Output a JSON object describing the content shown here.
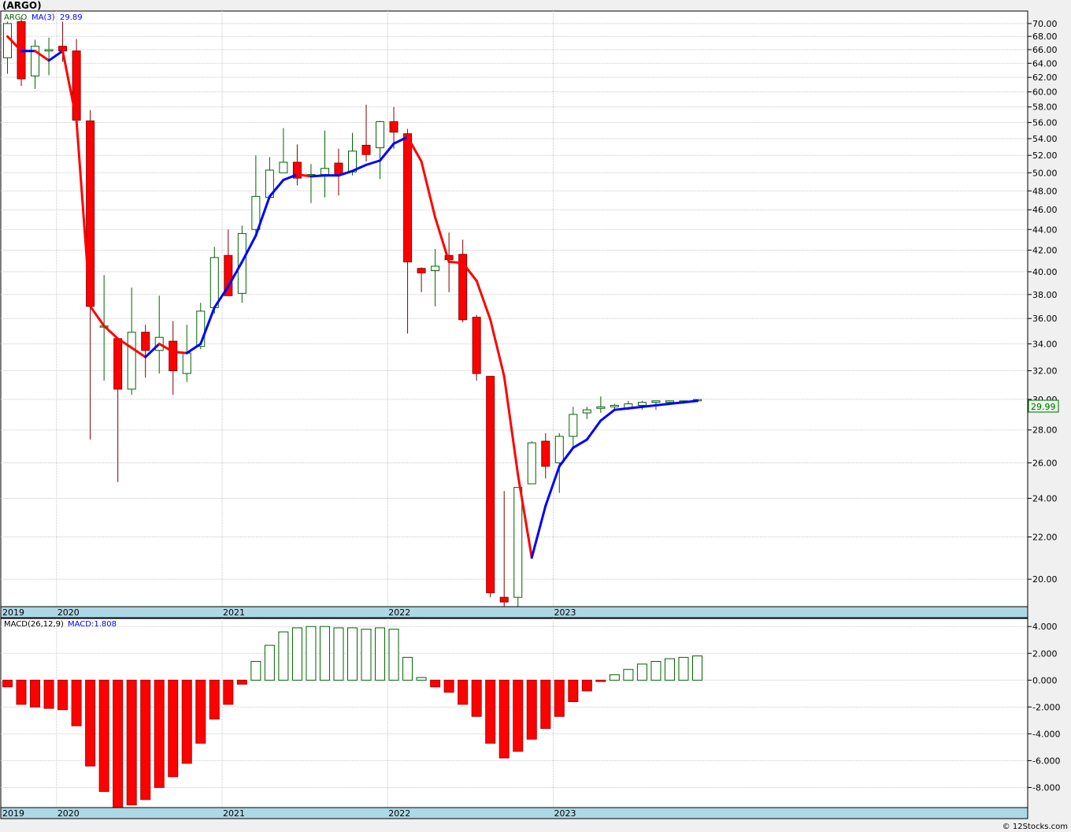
{
  "header": {
    "symbol_title": "(ARGO)",
    "footer_credit": "© 12Stocks.com"
  },
  "price_panel": {
    "legend_symbol": "ARGO",
    "legend_ma": "MA(3)",
    "legend_ma_value": "29.89",
    "last_price_label": "29.99"
  },
  "macd_panel": {
    "legend_macd": "MACD(26,12,9)",
    "legend_macd_value": "MACD:1.808"
  },
  "colors": {
    "down_fill": "#ff0000",
    "up_fill": "#ffffff",
    "up_border": "#006400",
    "ma_up": "#0000ff",
    "ma_down": "#ff0000",
    "macd_pos_border": "#006400",
    "macd_neg_fill": "#ff0000",
    "time_axis_bg": "#add8e6",
    "last_price_bg": "#e6ffe6"
  },
  "chart_data": [
    {
      "type": "candlestick",
      "title": "(ARGO)",
      "scale": "log",
      "ylim": [
        18.8,
        72.0
      ],
      "yticks": [
        "20.00",
        "22.00",
        "24.00",
        "26.00",
        "28.00",
        "30.00",
        "32.00",
        "34.00",
        "36.00",
        "38.00",
        "40.00",
        "42.00",
        "44.00",
        "46.00",
        "48.00",
        "50.00",
        "52.00",
        "54.00",
        "56.00",
        "58.00",
        "60.00",
        "62.00",
        "64.00",
        "66.00",
        "68.00",
        "70.00"
      ],
      "year_labels": [
        {
          "label": "2019",
          "index": 0
        },
        {
          "label": "2020",
          "index": 4
        },
        {
          "label": "2021",
          "index": 16
        },
        {
          "label": "2022",
          "index": 28
        },
        {
          "label": "2023",
          "index": 40
        }
      ],
      "candles": [
        {
          "o": 64.8,
          "h": 70.3,
          "l": 62.5,
          "c": 70.0
        },
        {
          "o": 70.3,
          "h": 70.8,
          "l": 60.8,
          "c": 61.8
        },
        {
          "o": 62.2,
          "h": 67.5,
          "l": 60.4,
          "c": 66.5
        },
        {
          "o": 65.8,
          "h": 67.8,
          "l": 62.3,
          "c": 66.0
        },
        {
          "o": 66.5,
          "h": 70.3,
          "l": 64.2,
          "c": 65.8
        },
        {
          "o": 65.8,
          "h": 67.6,
          "l": 55.8,
          "c": 56.3
        },
        {
          "o": 56.2,
          "h": 57.6,
          "l": 27.4,
          "c": 37.0
        },
        {
          "o": 35.4,
          "h": 39.7,
          "l": 31.3,
          "c": 35.4
        },
        {
          "o": 34.4,
          "h": 34.4,
          "l": 24.9,
          "c": 30.7
        },
        {
          "o": 30.7,
          "h": 38.6,
          "l": 30.3,
          "c": 34.9
        },
        {
          "o": 34.9,
          "h": 35.5,
          "l": 31.5,
          "c": 33.5
        },
        {
          "o": 33.5,
          "h": 37.9,
          "l": 31.8,
          "c": 34.5
        },
        {
          "o": 34.2,
          "h": 35.8,
          "l": 30.3,
          "c": 32.0
        },
        {
          "o": 31.8,
          "h": 35.5,
          "l": 31.2,
          "c": 33.3
        },
        {
          "o": 33.8,
          "h": 37.3,
          "l": 33.6,
          "c": 36.6
        },
        {
          "o": 36.9,
          "h": 42.3,
          "l": 36.4,
          "c": 41.3
        },
        {
          "o": 41.5,
          "h": 44.0,
          "l": 38.0,
          "c": 37.9
        },
        {
          "o": 38.1,
          "h": 44.4,
          "l": 37.3,
          "c": 43.6
        },
        {
          "o": 44.0,
          "h": 52.0,
          "l": 43.4,
          "c": 47.4
        },
        {
          "o": 47.3,
          "h": 51.8,
          "l": 47.1,
          "c": 50.3
        },
        {
          "o": 50.0,
          "h": 55.3,
          "l": 50.0,
          "c": 51.2
        },
        {
          "o": 51.2,
          "h": 53.3,
          "l": 48.6,
          "c": 49.4
        },
        {
          "o": 49.6,
          "h": 51.0,
          "l": 46.7,
          "c": 49.8
        },
        {
          "o": 49.8,
          "h": 55.0,
          "l": 47.3,
          "c": 50.5
        },
        {
          "o": 51.1,
          "h": 52.8,
          "l": 47.5,
          "c": 49.8
        },
        {
          "o": 50.1,
          "h": 54.7,
          "l": 49.7,
          "c": 52.5
        },
        {
          "o": 53.2,
          "h": 58.3,
          "l": 51.3,
          "c": 52.1
        },
        {
          "o": 52.9,
          "h": 56.2,
          "l": 49.3,
          "c": 56.1
        },
        {
          "o": 56.1,
          "h": 58.0,
          "l": 52.8,
          "c": 54.8
        },
        {
          "o": 54.6,
          "h": 55.2,
          "l": 34.8,
          "c": 40.9
        },
        {
          "o": 40.3,
          "h": 40.4,
          "l": 38.2,
          "c": 39.9
        },
        {
          "o": 40.1,
          "h": 42.1,
          "l": 37.0,
          "c": 40.5
        },
        {
          "o": 41.5,
          "h": 43.7,
          "l": 38.2,
          "c": 41.1
        },
        {
          "o": 41.6,
          "h": 43.0,
          "l": 35.7,
          "c": 35.9
        },
        {
          "o": 36.1,
          "h": 36.3,
          "l": 31.3,
          "c": 31.8
        },
        {
          "o": 31.6,
          "h": 31.6,
          "l": 19.2,
          "c": 19.4
        },
        {
          "o": 19.2,
          "h": 24.4,
          "l": 18.8,
          "c": 19.0
        },
        {
          "o": 19.2,
          "h": 24.6,
          "l": 18.8,
          "c": 24.6
        },
        {
          "o": 24.8,
          "h": 27.3,
          "l": 24.8,
          "c": 27.2
        },
        {
          "o": 27.3,
          "h": 27.8,
          "l": 25.1,
          "c": 25.8
        },
        {
          "o": 26.0,
          "h": 27.8,
          "l": 24.3,
          "c": 27.6
        },
        {
          "o": 27.6,
          "h": 29.5,
          "l": 26.9,
          "c": 29.0
        },
        {
          "o": 29.1,
          "h": 29.5,
          "l": 28.7,
          "c": 29.3
        },
        {
          "o": 29.4,
          "h": 30.2,
          "l": 29.1,
          "c": 29.5
        },
        {
          "o": 29.5,
          "h": 29.7,
          "l": 29.3,
          "c": 29.6
        },
        {
          "o": 29.4,
          "h": 29.9,
          "l": 29.3,
          "c": 29.7
        },
        {
          "o": 29.6,
          "h": 29.9,
          "l": 29.3,
          "c": 29.8
        },
        {
          "o": 29.8,
          "h": 29.9,
          "l": 29.3,
          "c": 29.9
        },
        {
          "o": 29.8,
          "h": 29.9,
          "l": 29.7,
          "c": 29.9
        },
        {
          "o": 29.8,
          "h": 29.9,
          "l": 29.7,
          "c": 29.9
        },
        {
          "o": 29.9,
          "h": 30.0,
          "l": 29.8,
          "c": 29.99
        }
      ],
      "ma_series": {
        "name": "MA(3)",
        "values": [
          68.0,
          65.8,
          65.8,
          64.4,
          65.8,
          56.3,
          37.0,
          35.4,
          34.4,
          33.7,
          33.0,
          34.0,
          33.4,
          33.3,
          34.0,
          36.9,
          38.7,
          40.9,
          43.4,
          47.4,
          49.2,
          49.8,
          49.6,
          49.7,
          49.7,
          50.2,
          50.9,
          51.4,
          53.4,
          54.2,
          51.3,
          45.2,
          40.9,
          40.8,
          39.2,
          35.9,
          31.6,
          25.3,
          21.0,
          23.6,
          25.8,
          26.9,
          27.4,
          28.6,
          29.3,
          29.4,
          29.5,
          29.6,
          29.7,
          29.8,
          29.9
        ]
      }
    },
    {
      "type": "bar",
      "title": "MACD(26,12,9)",
      "ylim": [
        -9.5,
        4.6
      ],
      "yticks": [
        "-8.000",
        "-6.000",
        "-4.000",
        "-2.000",
        "0.000",
        "2.000",
        "4.000"
      ],
      "values": [
        -0.5,
        -1.8,
        -2.0,
        -2.1,
        -2.2,
        -3.4,
        -6.4,
        -8.3,
        -9.5,
        -9.3,
        -8.9,
        -8.0,
        -7.2,
        -6.2,
        -4.7,
        -2.9,
        -1.8,
        -0.3,
        1.4,
        2.6,
        3.6,
        3.9,
        4.0,
        4.0,
        3.9,
        3.9,
        3.8,
        3.9,
        3.8,
        1.7,
        0.2,
        -0.5,
        -0.9,
        -1.8,
        -2.7,
        -4.7,
        -5.8,
        -5.3,
        -4.4,
        -3.6,
        -2.7,
        -1.6,
        -0.8,
        -0.1,
        0.4,
        0.8,
        1.2,
        1.4,
        1.6,
        1.7,
        1.808
      ]
    }
  ]
}
